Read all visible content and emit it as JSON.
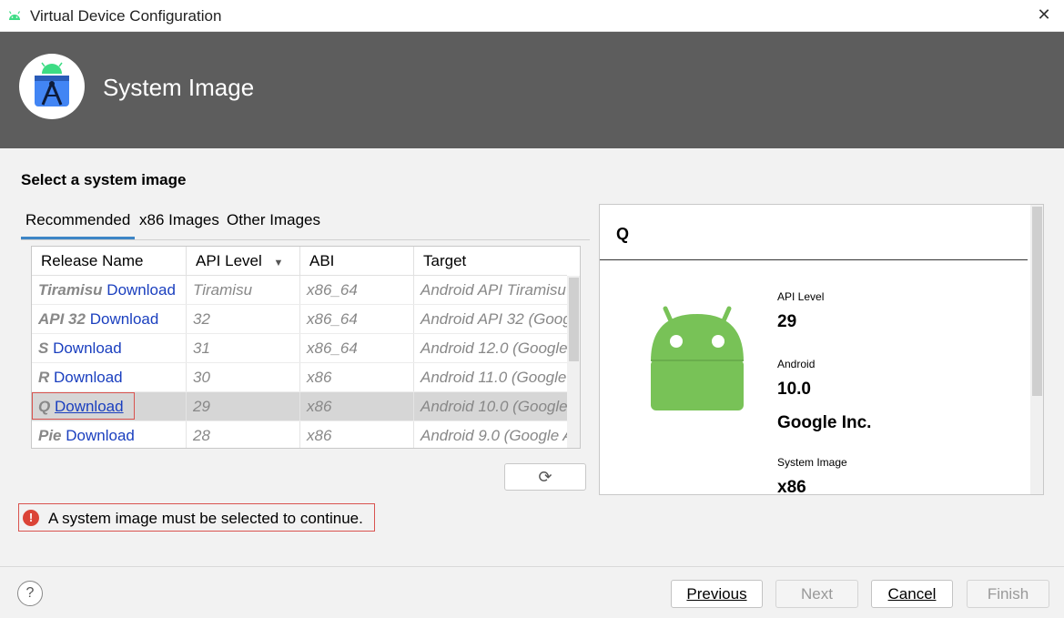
{
  "window": {
    "title": "Virtual Device Configuration"
  },
  "banner": {
    "title": "System Image"
  },
  "section": {
    "title": "Select a system image"
  },
  "tabs": [
    {
      "label": "Recommended"
    },
    {
      "label": "x86 Images"
    },
    {
      "label": "Other Images"
    }
  ],
  "table": {
    "columns": [
      "Release Name",
      "API Level",
      "ABI",
      "Target"
    ],
    "rows": [
      {
        "release": "Tiramisu",
        "download": "Download",
        "api": "Tiramisu",
        "abi": "x86_64",
        "target": "Android API Tiramisu"
      },
      {
        "release": "API 32",
        "download": "Download",
        "api": "32",
        "abi": "x86_64",
        "target": "Android API 32 (Google"
      },
      {
        "release": "S",
        "download": "Download",
        "api": "31",
        "abi": "x86_64",
        "target": "Android 12.0 (Google"
      },
      {
        "release": "R",
        "download": "Download",
        "api": "30",
        "abi": "x86",
        "target": "Android 11.0 (Google"
      },
      {
        "release": "Q",
        "download": "Download",
        "api": "29",
        "abi": "x86",
        "target": "Android 10.0 (Google"
      },
      {
        "release": "Pie",
        "download": "Download",
        "api": "28",
        "abi": "x86",
        "target": "Android 9.0 (Google A"
      }
    ]
  },
  "detail": {
    "title": "Q",
    "api_level_label": "API Level",
    "api_level": "29",
    "android_label": "Android",
    "android_version": "10.0",
    "vendor": "Google Inc.",
    "system_image_label": "System Image",
    "system_image": "x86"
  },
  "error": {
    "message": "A system image must be selected to continue."
  },
  "buttons": {
    "previous": "Previous",
    "next": "Next",
    "cancel": "Cancel",
    "finish": "Finish",
    "help": "?"
  },
  "colors": {
    "banner": "#5d5d5d",
    "android_green": "#78c257",
    "link": "#1a3fbf",
    "error": "#db4437"
  },
  "icons": [
    "android-logo-icon",
    "close-icon",
    "android-studio-icon",
    "sort-desc-icon",
    "refresh-icon",
    "android-robot-icon",
    "error-icon",
    "help-icon"
  ]
}
